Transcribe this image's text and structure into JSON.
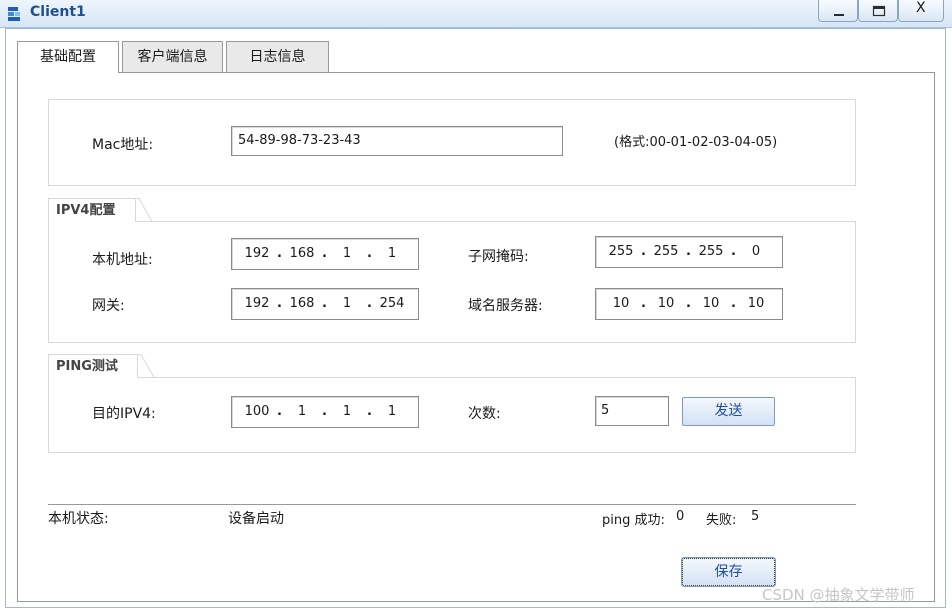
{
  "window": {
    "title": "Client1",
    "minimize_label": "_",
    "close_label": "X"
  },
  "tabs": [
    "基础配置",
    "客户端信息",
    "日志信息"
  ],
  "mac": {
    "label": "Mac地址:",
    "value": "54-89-98-73-23-43",
    "hint": "(格式:00-01-02-03-04-05)"
  },
  "ipv4": {
    "section_title": "IPV4配置",
    "host_label": "本机地址:",
    "host_ip": [
      "192",
      "168",
      "1",
      "1"
    ],
    "mask_label": "子网掩码:",
    "mask": [
      "255",
      "255",
      "255",
      "0"
    ],
    "gateway_label": "网关:",
    "gateway": [
      "192",
      "168",
      "1",
      "254"
    ],
    "dns_label": "域名服务器:",
    "dns": [
      "10",
      "10",
      "10",
      "10"
    ]
  },
  "ping": {
    "section_title": "PING测试",
    "target_label": "目的IPV4:",
    "target": [
      "100",
      "1",
      "1",
      "1"
    ],
    "count_label": "次数:",
    "count": "5",
    "send_label": "发送"
  },
  "status": {
    "label": "本机状态:",
    "value": "设备启动",
    "ping_success_label": "ping 成功:",
    "ping_success": "0",
    "fail_label": "失败:",
    "fail": "5"
  },
  "save_label": "保存",
  "watermark": "CSDN @抽象文学带师"
}
